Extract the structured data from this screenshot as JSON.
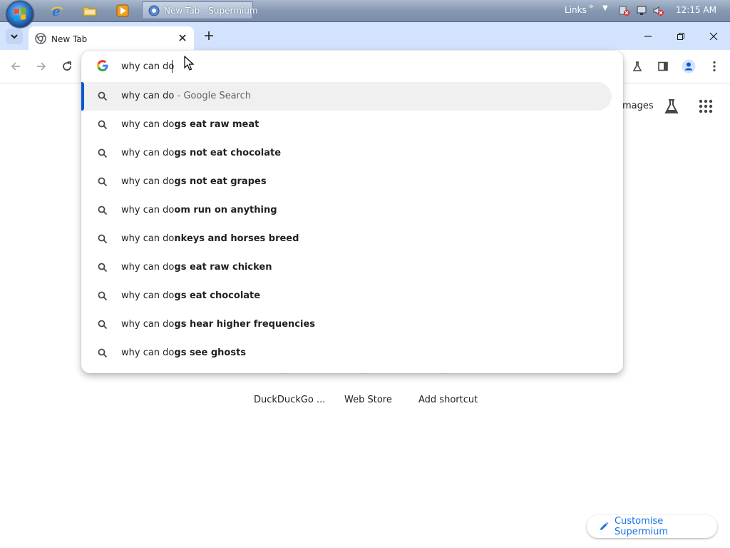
{
  "taskbar": {
    "start_icon": "windows-start-orb",
    "quick_launch": [
      "internet-explorer-icon",
      "folder-icon",
      "media-player-icon"
    ],
    "task_button_label": "New Tab - Supermium",
    "links_label": "Links",
    "clock": "12:15 AM"
  },
  "browser": {
    "tab_title": "New Tab",
    "toolbar_icons": [
      "back-icon",
      "forward-icon",
      "reload-icon",
      "labs-icon",
      "side-panel-icon",
      "profile-icon",
      "menu-icon"
    ],
    "accent_color": "#0b57d0"
  },
  "omnibox": {
    "input_value": "why can do",
    "suggestions": [
      {
        "typed": "why can do",
        "completion": "",
        "suffix": "Google Search",
        "selected": true
      },
      {
        "typed": "why can do",
        "completion": "gs eat raw meat"
      },
      {
        "typed": "why can do",
        "completion": "gs not eat chocolate"
      },
      {
        "typed": "why can do",
        "completion": "gs not eat grapes"
      },
      {
        "typed": "why can do",
        "completion": "om run on anything"
      },
      {
        "typed": "why can do",
        "completion": "nkeys and horses breed"
      },
      {
        "typed": "why can do",
        "completion": "gs eat raw chicken"
      },
      {
        "typed": "why can do",
        "completion": "gs eat chocolate"
      },
      {
        "typed": "why can do",
        "completion": "gs hear higher frequencies"
      },
      {
        "typed": "why can do",
        "completion": "gs see ghosts"
      }
    ]
  },
  "ntp": {
    "images_link": "mages",
    "shortcuts": [
      "DuckDuckGo ...",
      "Web Store",
      "Add shortcut"
    ],
    "customise_label": "Customise Supermium"
  }
}
